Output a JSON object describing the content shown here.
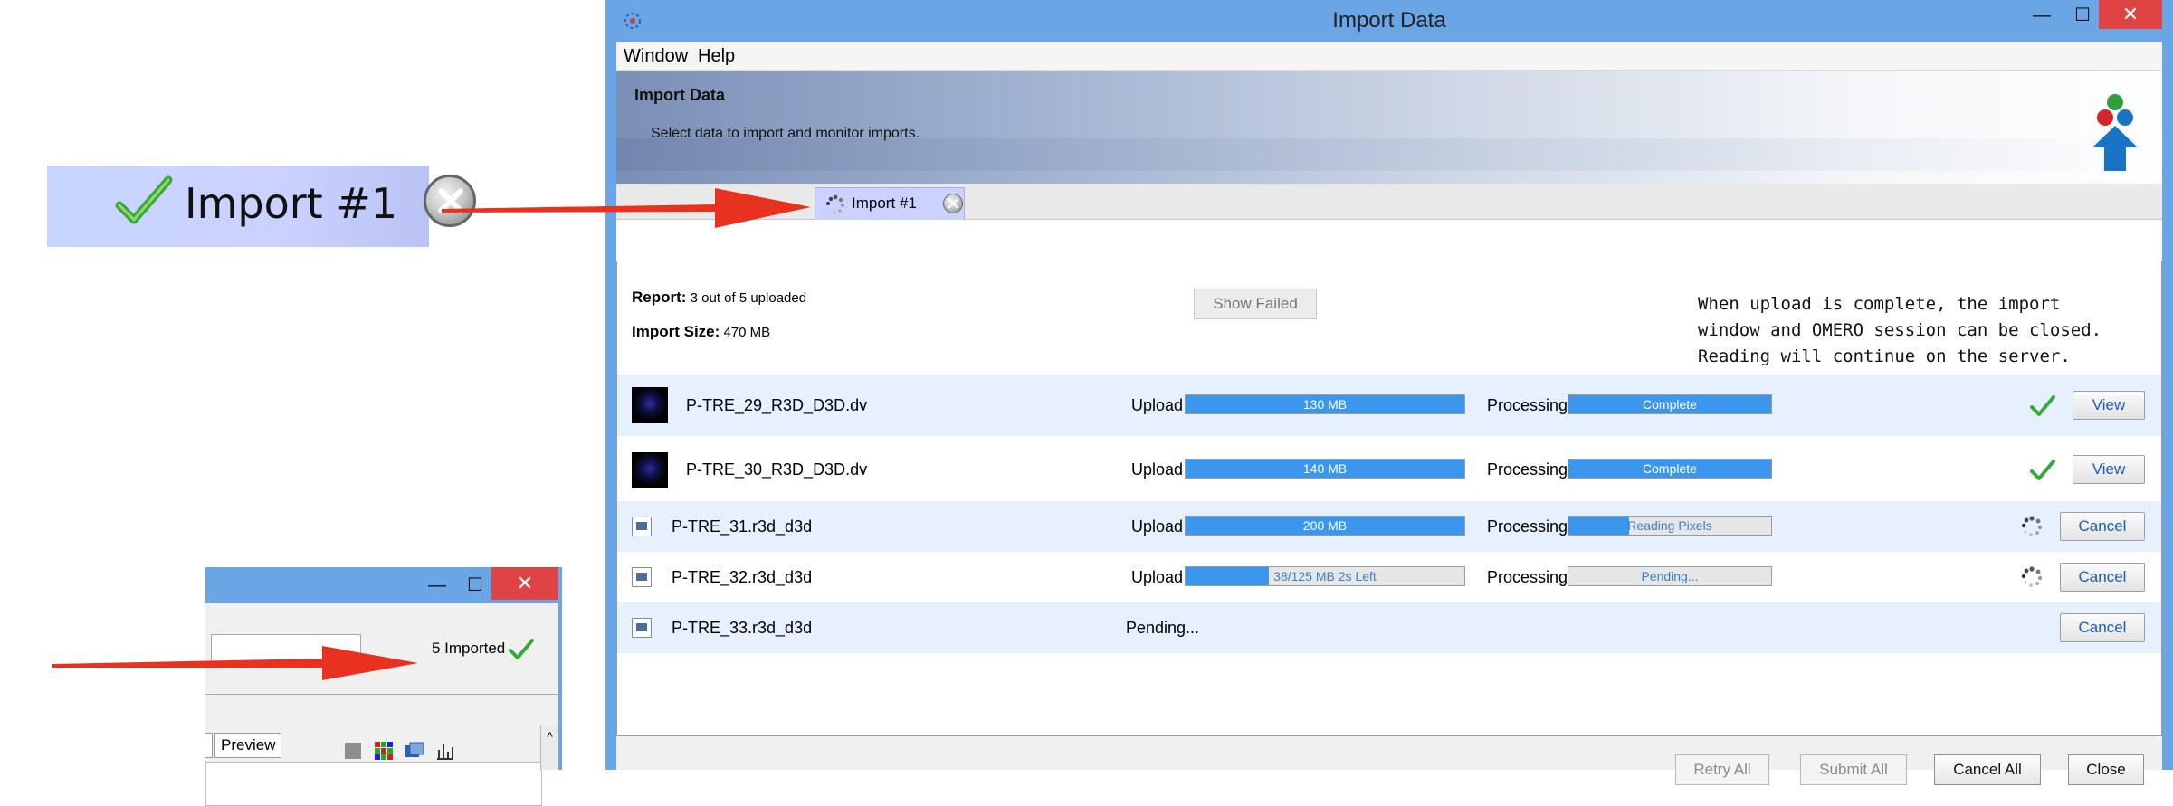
{
  "zoom_callout": {
    "label": "Import #1"
  },
  "mini_window": {
    "status_text": "5 Imported",
    "preview_tab": "Preview",
    "controls": {
      "minimize": "—",
      "maximize": "☐",
      "close": "✕"
    },
    "scroll_up": "^"
  },
  "window": {
    "title": "Import Data",
    "controls": {
      "minimize": "—",
      "maximize": "☐",
      "close": "✕"
    },
    "menu": {
      "window": "Window",
      "help": "Help"
    },
    "banner": {
      "title": "Import Data",
      "subtitle": "Select data to import and monitor imports."
    },
    "tab": {
      "label": "Import #1"
    },
    "report": {
      "report_label": "Report:",
      "report_value": "3 out of 5 uploaded",
      "size_label": "Import Size:",
      "size_value": "470 MB",
      "show_failed": "Show Failed",
      "notice": "When upload is complete, the import\nwindow and OMERO session can be closed.\nReading will continue on the server."
    },
    "rows": [
      {
        "name": "P-TRE_29_R3D_D3D.dv",
        "upload_label": "Upload",
        "upload_text": "130 MB",
        "upload_fill": 1.0,
        "proc_label": "Processing",
        "proc_text": "Complete",
        "proc_fill": 1.0,
        "action": "View"
      },
      {
        "name": "P-TRE_30_R3D_D3D.dv",
        "upload_label": "Upload",
        "upload_text": "140 MB",
        "upload_fill": 1.0,
        "proc_label": "Processing",
        "proc_text": "Complete",
        "proc_fill": 1.0,
        "action": "View"
      },
      {
        "name": "P-TRE_31.r3d_d3d",
        "upload_label": "Upload",
        "upload_text": "200 MB",
        "upload_fill": 1.0,
        "proc_label": "Processing",
        "proc_text": "Reading Pixels",
        "proc_fill": 0.3,
        "action": "Cancel"
      },
      {
        "name": "P-TRE_32.r3d_d3d",
        "upload_label": "Upload",
        "upload_text": "38/125 MB  2s Left",
        "upload_fill": 0.3,
        "proc_label": "Processing",
        "proc_text": "Pending...",
        "proc_fill": 0.0,
        "action": "Cancel"
      },
      {
        "name": "P-TRE_33.r3d_d3d",
        "pending_text": "Pending...",
        "action": "Cancel"
      }
    ],
    "footer": {
      "retry_all": "Retry All",
      "submit_all": "Submit All",
      "cancel_all": "Cancel All",
      "close": "Close"
    }
  },
  "colors": {
    "window_frame": "#6aa6e6",
    "progress": "#3a97ed",
    "arrow": "#e8321f",
    "close_button": "#e04343",
    "check": "#3bb33b"
  }
}
